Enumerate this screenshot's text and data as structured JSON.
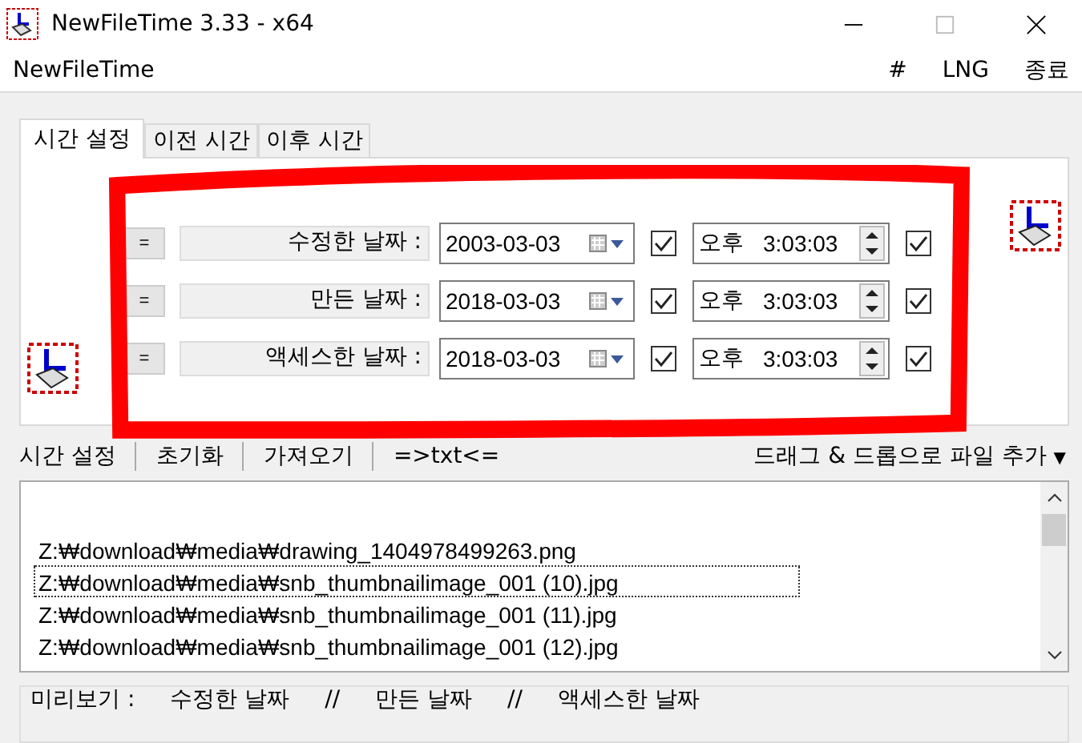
{
  "window": {
    "title": "NewFileTime 3.33 - x64"
  },
  "menu": {
    "app_name": "NewFileTime",
    "items": [
      "#",
      "LNG",
      "종료"
    ]
  },
  "tabs": [
    {
      "label": "시간 설정",
      "selected": true
    },
    {
      "label": "이전 시간",
      "selected": false
    },
    {
      "label": "이후 시간",
      "selected": false
    }
  ],
  "time_rows": [
    {
      "button": "=",
      "label": "수정한 날짜 :",
      "date": "2003-03-03",
      "date_checked": true,
      "period": "오후",
      "time": "3:03:03",
      "time_checked": true
    },
    {
      "button": "=",
      "label": "만든 날짜 :",
      "date": "2018-03-03",
      "date_checked": true,
      "period": "오후",
      "time": "3:03:03",
      "time_checked": true
    },
    {
      "button": "=",
      "label": "액세스한 날짜 :",
      "date": "2018-03-03",
      "date_checked": true,
      "period": "오후",
      "time": "3:03:03",
      "time_checked": true
    }
  ],
  "toolbar": {
    "items": [
      "시간 설정",
      "초기화",
      "가져오기",
      "=>txt<="
    ],
    "drop_menu": "드래그 & 드롭으로 파일 추가",
    "caret": "▼"
  },
  "files": [
    {
      "path": "Z:₩download₩media₩drawing_1404978499263.png",
      "selected": false
    },
    {
      "path": "Z:₩download₩media₩snb_thumbnailimage_001 (10).jpg",
      "selected": true
    },
    {
      "path": "Z:₩download₩media₩snb_thumbnailimage_001 (11).jpg",
      "selected": false
    },
    {
      "path": "Z:₩download₩media₩snb_thumbnailimage_001 (12).jpg",
      "selected": false
    }
  ],
  "preview": {
    "label": "미리보기 :",
    "columns": [
      "수정한 날짜",
      "//",
      "만든 날짜",
      "//",
      "액세스한 날짜"
    ]
  }
}
